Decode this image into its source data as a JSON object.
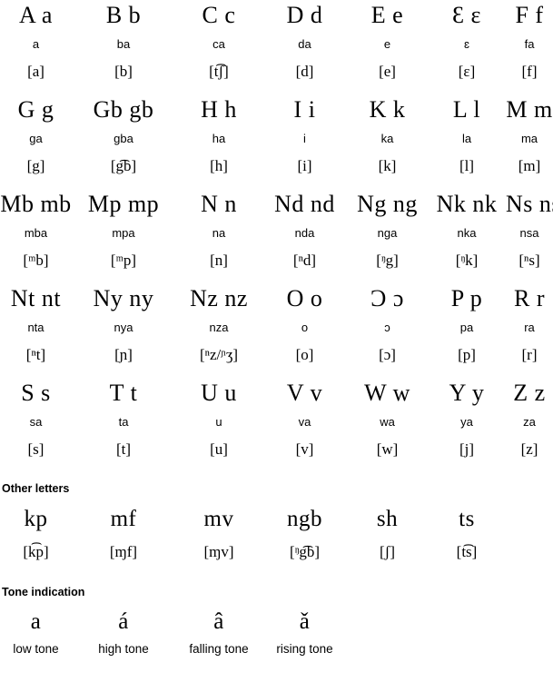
{
  "alphabet": {
    "rows": [
      [
        {
          "letters": "A a",
          "name": "a",
          "ipa": "[a]"
        },
        {
          "letters": "B b",
          "name": "ba",
          "ipa": "[b]"
        },
        {
          "letters": "C c",
          "name": "ca",
          "ipa": "[t͡ʃ]"
        },
        {
          "letters": "D d",
          "name": "da",
          "ipa": "[d]"
        },
        {
          "letters": "E e",
          "name": "e",
          "ipa": "[e]"
        },
        {
          "letters": "Ɛ ɛ",
          "name": "ɛ",
          "ipa": "[ɛ]"
        },
        {
          "letters": "F f",
          "name": "fa",
          "ipa": "[f]"
        }
      ],
      [
        {
          "letters": "G g",
          "name": "ga",
          "ipa": "[g]"
        },
        {
          "letters": "Gb gb",
          "name": "gba",
          "ipa": "[g͡b]"
        },
        {
          "letters": "H h",
          "name": "ha",
          "ipa": "[h]"
        },
        {
          "letters": "I i",
          "name": "i",
          "ipa": "[i]"
        },
        {
          "letters": "K k",
          "name": "ka",
          "ipa": "[k]"
        },
        {
          "letters": "L l",
          "name": "la",
          "ipa": "[l]"
        },
        {
          "letters": "M m",
          "name": "ma",
          "ipa": "[m]"
        }
      ],
      [
        {
          "letters": "Mb mb",
          "name": "mba",
          "ipa": "[ᵐb]"
        },
        {
          "letters": "Mp mp",
          "name": "mpa",
          "ipa": "[ᵐp]"
        },
        {
          "letters": "N n",
          "name": "na",
          "ipa": "[n]"
        },
        {
          "letters": "Nd nd",
          "name": "nda",
          "ipa": "[ⁿd]"
        },
        {
          "letters": "Ng ng",
          "name": "nga",
          "ipa": "[ᵑg]"
        },
        {
          "letters": "Nk nk",
          "name": "nka",
          "ipa": "[ᵑk]"
        },
        {
          "letters": "Ns ns",
          "name": "nsa",
          "ipa": "[ⁿs]"
        }
      ],
      [
        {
          "letters": "Nt nt",
          "name": "nta",
          "ipa": "[ⁿt]"
        },
        {
          "letters": "Ny ny",
          "name": "nya",
          "ipa": "[ɲ]"
        },
        {
          "letters": "Nz nz",
          "name": "nza",
          "ipa": "[ⁿz/ᶮʒ]"
        },
        {
          "letters": "O o",
          "name": "o",
          "ipa": "[o]"
        },
        {
          "letters": "Ɔ ɔ",
          "name": "ɔ",
          "ipa": "[ɔ]"
        },
        {
          "letters": "P p",
          "name": "pa",
          "ipa": "[p]"
        },
        {
          "letters": "R r",
          "name": "ra",
          "ipa": "[r]"
        }
      ],
      [
        {
          "letters": "S s",
          "name": "sa",
          "ipa": "[s]"
        },
        {
          "letters": "T t",
          "name": "ta",
          "ipa": "[t]"
        },
        {
          "letters": "U u",
          "name": "u",
          "ipa": "[u]"
        },
        {
          "letters": "V v",
          "name": "va",
          "ipa": "[v]"
        },
        {
          "letters": "W w",
          "name": "wa",
          "ipa": "[w]"
        },
        {
          "letters": "Y y",
          "name": "ya",
          "ipa": "[j]"
        },
        {
          "letters": "Z z",
          "name": "za",
          "ipa": "[z]"
        }
      ]
    ]
  },
  "other_letters": {
    "heading": "Other letters",
    "items": [
      {
        "letters": "kp",
        "ipa": "[k͡p]"
      },
      {
        "letters": "mf",
        "ipa": "[ɱf]"
      },
      {
        "letters": "mv",
        "ipa": "[ɱv]"
      },
      {
        "letters": "ngb",
        "ipa": "[ᵑg͡b]"
      },
      {
        "letters": "sh",
        "ipa": "[ʃ]"
      },
      {
        "letters": "ts",
        "ipa": "[t͡s]"
      }
    ]
  },
  "tone_indication": {
    "heading": "Tone indication",
    "items": [
      {
        "letters": "a",
        "label": "low tone"
      },
      {
        "letters": "á",
        "label": "high tone"
      },
      {
        "letters": "â",
        "label": "falling tone"
      },
      {
        "letters": "ǎ",
        "label": "rising tone"
      }
    ]
  }
}
